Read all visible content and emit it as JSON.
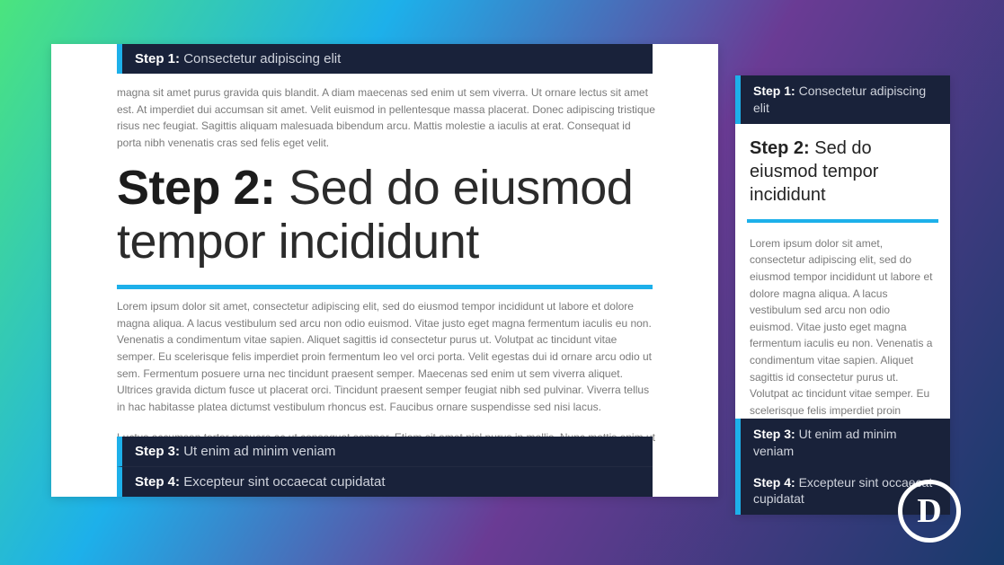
{
  "left": {
    "step1": {
      "label": "Step 1:",
      "title": "Consectetur adipiscing elit"
    },
    "para1": "magna sit amet purus gravida quis blandit. A diam maecenas sed enim ut sem viverra. Ut ornare lectus sit amet est. At imperdiet dui accumsan sit amet. Velit euismod in pellentesque massa placerat. Donec adipiscing tristique risus nec feugiat. Sagittis aliquam malesuada bibendum arcu. Mattis molestie a iaculis at erat. Consequat id porta nibh venenatis cras sed felis eget velit.",
    "step2": {
      "label": "Step 2:",
      "title": "Sed do eiusmod tempor incididunt"
    },
    "para2": "Lorem ipsum dolor sit amet, consectetur adipiscing elit, sed do eiusmod tempor incididunt ut labore et dolore magna aliqua. A lacus vestibulum sed arcu non odio euismod. Vitae justo eget magna fermentum iaculis eu non. Venenatis a condimentum vitae sapien. Aliquet sagittis id consectetur purus ut. Volutpat ac tincidunt vitae semper. Eu scelerisque felis imperdiet proin fermentum leo vel orci porta. Velit egestas dui id ornare arcu odio ut sem. Fermentum posuere urna nec tincidunt praesent semper. Maecenas sed enim ut sem viverra aliquet. Ultrices gravida dictum fusce ut placerat orci. Tincidunt praesent semper feugiat nibh sed pulvinar. Viverra tellus in hac habitasse platea dictumst vestibulum rhoncus est. Faucibus ornare suspendisse sed nisi lacus.",
    "para3": "Luctus accumsan tortor posuere ac ut consequat semper. Etiam sit amet nisl purus in mollis. Nunc mattis enim ut tellus elementum sagittis vitae et. Elit scelerisque mauris pellentesque pulvinar pellentesque habitant morbi tristique senectus. Dignissim cras tincidunt lobortis feugiat vivamus at. Sed arcu non odio euismod. Risus pretium quam vulputate dignissim suspendisse in est ante in. Quis auctor elit sed vulputate. Nulla facilisi morbi tempus iaculis urna. Neque gravida in fermentum et sollicitudin ac orci. Augue ut lectus arcu bibendum at varius vel. Id diam vel quam elementum pulvinar etiam.",
    "step3": {
      "label": "Step 3:",
      "title": "Ut enim ad minim veniam"
    },
    "step4": {
      "label": "Step 4:",
      "title": "Excepteur sint occaecat cupidatat"
    }
  },
  "side": {
    "step1": {
      "label": "Step 1:",
      "title": "Consectetur adipiscing elit"
    },
    "step2": {
      "label": "Step 2:",
      "title": "Sed do eiusmod tempor incididunt"
    },
    "body": "Lorem ipsum dolor sit amet, consectetur adipiscing elit, sed do eiusmod tempor incididunt ut labore et dolore magna aliqua. A lacus vestibulum sed arcu non odio euismod. Vitae justo eget magna fermentum iaculis eu non. Venenatis a condimentum vitae sapien. Aliquet sagittis id consectetur purus ut. Volutpat ac tincidunt vitae semper. Eu scelerisque felis imperdiet proin fermentum leo vel orci porta. Velit egestas dui id ornare arcu odio",
    "step3": {
      "label": "Step 3:",
      "title": "Ut enim ad minim veniam"
    },
    "step4": {
      "label": "Step 4:",
      "title": "Excepteur sint occaecat cupidatat"
    }
  },
  "logo": {
    "letter": "D"
  },
  "colors": {
    "accent": "#1db0ea",
    "bar_bg": "#19223a"
  }
}
